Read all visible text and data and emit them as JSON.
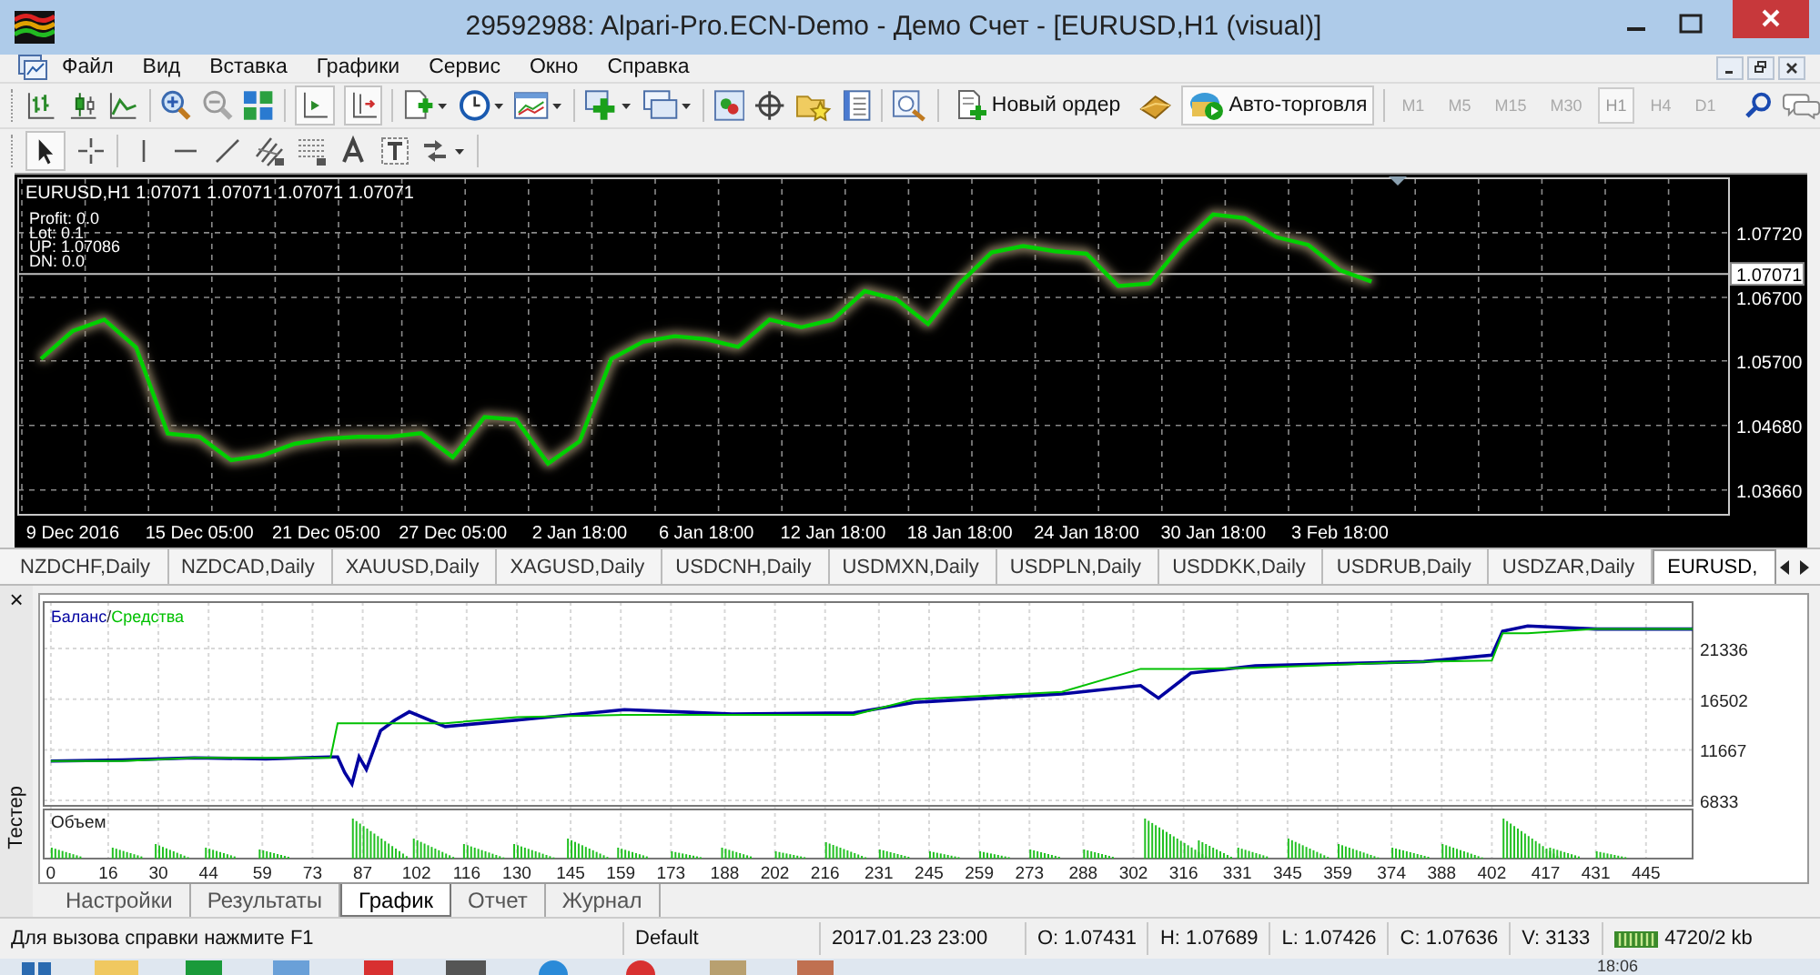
{
  "window": {
    "title": "29592988: Alpari-Pro.ECN-Demo - Демо Счет - [EURUSD,H1 (visual)]"
  },
  "menu": [
    "Файл",
    "Вид",
    "Вставка",
    "Графики",
    "Сервис",
    "Окно",
    "Справка"
  ],
  "toolbar": {
    "autoscroll": true,
    "chart_shift": true,
    "new_order": "Новый ордер",
    "auto_trading": {
      "label": "Авто-торговля",
      "on": true
    },
    "timeframes": [
      {
        "label": "M1",
        "selected": false
      },
      {
        "label": "M5",
        "selected": false
      },
      {
        "label": "M15",
        "selected": false
      },
      {
        "label": "M30",
        "selected": false
      },
      {
        "label": "H1",
        "selected": true
      },
      {
        "label": "H4",
        "selected": false
      },
      {
        "label": "D1",
        "selected": false
      }
    ]
  },
  "drawing_toolbar": {
    "cursor": true
  },
  "chart": {
    "header": "EURUSD,H1  1.07071 1.07071 1.07071 1.07071",
    "info": [
      "Profit: 0.0",
      "Lot: 0.1",
      "UP: 1.07086",
      "DN: 0.0"
    ],
    "price_label": "1.07071",
    "chart_data": {
      "type": "line",
      "grid": true,
      "categories": [
        null,
        "9 Dec 2016",
        null,
        null,
        null,
        "15 Dec 05:00",
        null,
        null,
        null,
        "21 Dec 05:00",
        null,
        null,
        null,
        "27 Dec 05:00",
        null,
        null,
        null,
        "2 Jan 18:00",
        null,
        null,
        null,
        "6 Jan 18:00",
        null,
        null,
        null,
        "12 Jan 18:00",
        null,
        null,
        null,
        "18 Jan 18:00",
        null,
        null,
        null,
        "24 Jan 18:00",
        null,
        null,
        null,
        "30 Jan 18:00",
        null,
        null,
        null,
        "3 Feb 18:00",
        null,
        null,
        null,
        null,
        null,
        null,
        null,
        null,
        null,
        null,
        null,
        null
      ],
      "series": [
        {
          "color": "#00d000",
          "values": [
            1.0573,
            1.0617,
            1.0635,
            1.0591,
            1.0455,
            1.045,
            1.0413,
            1.0421,
            1.0439,
            1.0447,
            1.045,
            1.045,
            1.0456,
            1.0418,
            1.0481,
            1.0477,
            1.0408,
            1.0443,
            1.0573,
            1.06,
            1.0609,
            1.0604,
            1.0592,
            1.0635,
            1.0623,
            1.0635,
            1.068,
            1.0667,
            1.0628,
            1.0692,
            1.0741,
            1.0751,
            1.0743,
            1.0739,
            1.0688,
            1.0692,
            1.0753,
            1.0801,
            1.0795,
            1.0765,
            1.0753,
            1.0713,
            1.0695,
            null,
            null,
            null,
            null,
            null,
            null,
            null,
            null,
            null,
            null,
            null
          ]
        }
      ],
      "ref_lines": [
        {
          "axis": "y",
          "value": 1.07071
        }
      ],
      "ylim": [
        1.0327,
        1.0858
      ],
      "yticks": [
        {
          "value": 1.0772,
          "label": "1.07720"
        },
        {
          "value": 1.067,
          "label": "1.06700"
        },
        {
          "value": 1.057,
          "label": "1.05700"
        },
        {
          "value": 1.0468,
          "label": "1.04680"
        },
        {
          "value": 1.0366,
          "label": "1.03660"
        }
      ]
    }
  },
  "symbol_tabs": [
    {
      "label": "NZDCHF,Daily",
      "selected": false
    },
    {
      "label": "NZDCAD,Daily",
      "selected": false
    },
    {
      "label": "XAUUSD,Daily",
      "selected": false
    },
    {
      "label": "XAGUSD,Daily",
      "selected": false
    },
    {
      "label": "USDCNH,Daily",
      "selected": false
    },
    {
      "label": "USDMXN,Daily",
      "selected": false
    },
    {
      "label": "USDPLN,Daily",
      "selected": false
    },
    {
      "label": "USDDKK,Daily",
      "selected": false
    },
    {
      "label": "USDRUB,Daily",
      "selected": false
    },
    {
      "label": "USDZAR,Daily",
      "selected": false
    },
    {
      "label": "EURUSD,",
      "selected": true
    }
  ],
  "tester": {
    "title": "Тестер",
    "close": "×",
    "legend_separator": "/",
    "volume_label": "Объем",
    "chart_data": {
      "type": "line",
      "grid": true,
      "x": [
        0,
        20,
        40,
        60,
        78,
        80,
        82,
        84,
        86,
        88,
        92,
        96,
        100,
        110,
        130,
        160,
        190,
        224,
        241,
        282,
        304,
        309,
        318,
        336,
        383,
        402,
        405,
        412,
        431,
        458
      ],
      "series": [
        {
          "name": "Баланс",
          "color": "#0000a0",
          "values": [
            10600,
            10700,
            10900,
            10800,
            11000,
            11000,
            9500,
            8400,
            11000,
            9800,
            13500,
            14500,
            15300,
            13900,
            14500,
            15500,
            15100,
            15200,
            16200,
            17000,
            17800,
            16600,
            19000,
            19700,
            20100,
            20700,
            23000,
            23500,
            23200,
            23200
          ]
        },
        {
          "name": "Средства",
          "color": "#00c000",
          "values": [
            10600,
            10600,
            10900,
            10900,
            10900,
            14200,
            14200,
            14200,
            14200,
            14200,
            14200,
            14200,
            14200,
            14200,
            14800,
            15000,
            15000,
            15000,
            16500,
            17200,
            19400,
            19400,
            19400,
            19500,
            20100,
            20200,
            22800,
            22800,
            23200,
            23200
          ]
        }
      ],
      "xlim": [
        -2,
        458
      ],
      "ylim": [
        6321,
        25772
      ],
      "xticks": [
        0,
        16,
        30,
        44,
        59,
        73,
        87,
        102,
        116,
        130,
        145,
        159,
        173,
        188,
        202,
        216,
        231,
        245,
        259,
        273,
        288,
        302,
        316,
        331,
        345,
        359,
        374,
        388,
        402,
        417,
        431,
        445
      ],
      "yticks": [
        6833,
        11667,
        16502,
        21336
      ]
    },
    "tabs": [
      {
        "label": "Настройки",
        "selected": false
      },
      {
        "label": "Результаты",
        "selected": false
      },
      {
        "label": "График",
        "selected": true
      },
      {
        "label": "Отчет",
        "selected": false
      },
      {
        "label": "Журнал",
        "selected": false
      }
    ]
  },
  "status_bar": {
    "help": "Для вызова справки нажмите F1",
    "profile": "Default",
    "time": "2017.01.23 23:00",
    "open": "O: 1.07431",
    "high": "H: 1.07689",
    "low": "L: 1.07426",
    "close": "C: 1.07636",
    "volume": "V: 3133",
    "traffic": "4720/2 kb"
  },
  "taskbar": {
    "clock": "18:06"
  }
}
